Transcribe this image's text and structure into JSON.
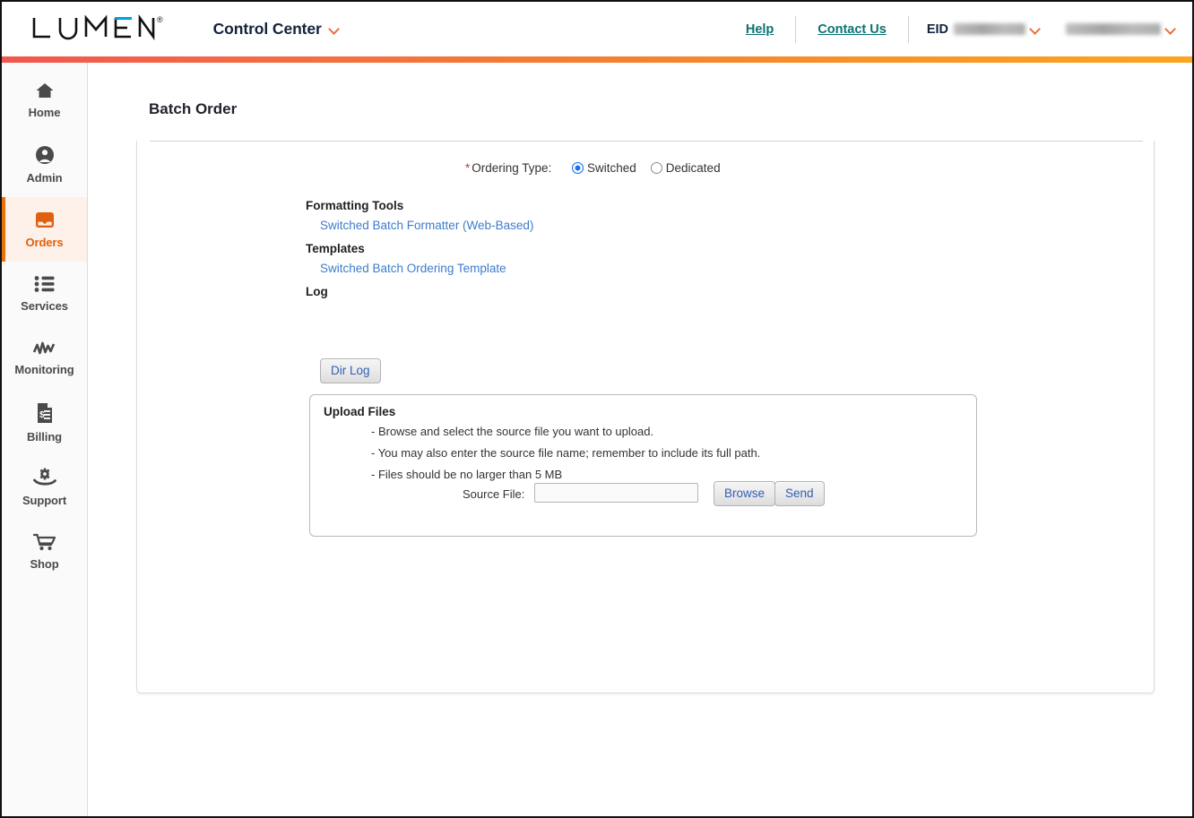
{
  "header": {
    "logo_text": "LUMEN",
    "logo_registered": "®",
    "app_name": "Control Center",
    "app_chevron_icon": "chevron-down-icon",
    "help_label": "Help",
    "contact_label": "Contact Us",
    "eid_label": "EID",
    "eid_value_redacted": true,
    "account_value_redacted": true,
    "eid_chevron_icon": "chevron-down-icon",
    "account_chevron_icon": "chevron-down-icon",
    "accent_gradient_from": "#f1564f",
    "accent_gradient_to": "#fba520"
  },
  "sidebar": {
    "active_index": 2,
    "active_color": "#e06010",
    "items": [
      {
        "label": "Home",
        "icon": "home-icon"
      },
      {
        "label": "Admin",
        "icon": "user-circle-icon"
      },
      {
        "label": "Orders",
        "icon": "inbox-tray-icon"
      },
      {
        "label": "Services",
        "icon": "list-icon"
      },
      {
        "label": "Monitoring",
        "icon": "activity-chart-icon"
      },
      {
        "label": "Billing",
        "icon": "invoice-dollar-icon"
      },
      {
        "label": "Support",
        "icon": "gear-in-hand-icon"
      },
      {
        "label": "Shop",
        "icon": "shopping-cart-icon"
      }
    ]
  },
  "main": {
    "page_title": "Batch Order",
    "ordering_type": {
      "required_marker": "*",
      "label": "Ordering Type:",
      "options": [
        {
          "label": "Switched",
          "checked": true
        },
        {
          "label": "Dedicated",
          "checked": false
        }
      ]
    },
    "formatting_tools": {
      "heading": "Formatting Tools",
      "link": "Switched Batch Formatter (Web-Based)"
    },
    "templates": {
      "heading": "Templates",
      "link": "Switched Batch Ordering Template"
    },
    "log": {
      "heading": "Log",
      "button": "Dir Log"
    },
    "upload": {
      "title": "Upload Files",
      "bullets": [
        "- Browse and select the source file you want to upload.",
        "- You may also enter the source file name; remember to include its full path.",
        "- Files should be no larger than 5 MB"
      ],
      "source_file_label": "Source File:",
      "source_file_value": "",
      "source_file_placeholder": "",
      "browse_button": "Browse",
      "send_button": "Send"
    }
  }
}
